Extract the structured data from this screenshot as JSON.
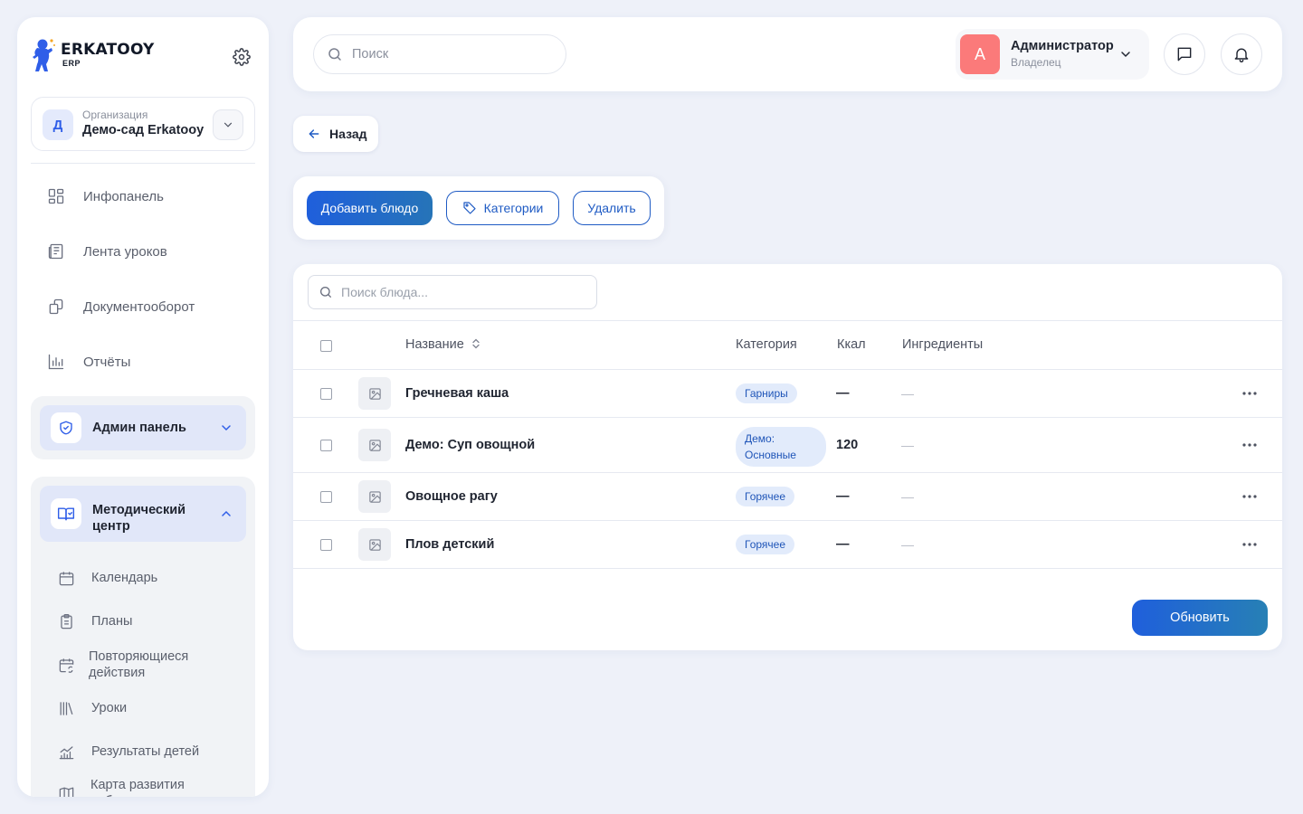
{
  "brand": {
    "name": "ERKATOOY",
    "sub": "ERP"
  },
  "org": {
    "label": "Организация",
    "name": "Демо-сад Erkatooy",
    "initial": "Д"
  },
  "nav": {
    "items": [
      {
        "label": "Инфопанель",
        "icon": "grid-icon"
      },
      {
        "label": "Лента уроков",
        "icon": "newspaper-icon"
      },
      {
        "label": "Документооборот",
        "icon": "documents-icon"
      },
      {
        "label": "Отчёты",
        "icon": "bar-chart-icon"
      }
    ],
    "admin": {
      "label": "Админ панель",
      "icon": "shield-check-icon"
    },
    "method": {
      "label": "Методический центр",
      "icon": "open-book-icon",
      "items": [
        {
          "label": "Календарь",
          "icon": "calendar-icon"
        },
        {
          "label": "Планы",
          "icon": "clipboard-icon"
        },
        {
          "label": "Повторяющиеся действия",
          "icon": "calendar-repeat-icon"
        },
        {
          "label": "Уроки",
          "icon": "books-icon"
        },
        {
          "label": "Результаты детей",
          "icon": "chart-line-icon"
        },
        {
          "label": "Карта развития ребенка",
          "icon": "map-icon"
        }
      ]
    }
  },
  "header": {
    "search_placeholder": "Поиск",
    "user": {
      "initial": "А",
      "name": "Администратор",
      "role": "Владелец"
    }
  },
  "back": {
    "label": "Назад"
  },
  "actions": {
    "add": "Добавить блюдо",
    "categories": "Категории",
    "delete": "Удалить"
  },
  "table": {
    "search_placeholder": "Поиск блюда...",
    "columns": {
      "name": "Название",
      "category": "Категория",
      "kcal": "Ккал",
      "ingredients": "Ингредиенты"
    },
    "rows": [
      {
        "name": "Гречневая каша",
        "category": "Гарниры",
        "kcal": "—",
        "ingredients": "—"
      },
      {
        "name": "Демо: Суп овощной",
        "category": "Демо: Основные",
        "kcal": "120",
        "ingredients": "—"
      },
      {
        "name": "Овощное рагу",
        "category": "Горячее",
        "kcal": "—",
        "ingredients": "—"
      },
      {
        "name": "Плов детский",
        "category": "Горячее",
        "kcal": "—",
        "ingredients": "—"
      }
    ],
    "refresh": "Обновить"
  },
  "colors": {
    "primary": "#1f5fdc",
    "chip_bg": "#e2ebfb",
    "avatar": "#fb7a7a",
    "group_active": "#e1e7f9"
  }
}
